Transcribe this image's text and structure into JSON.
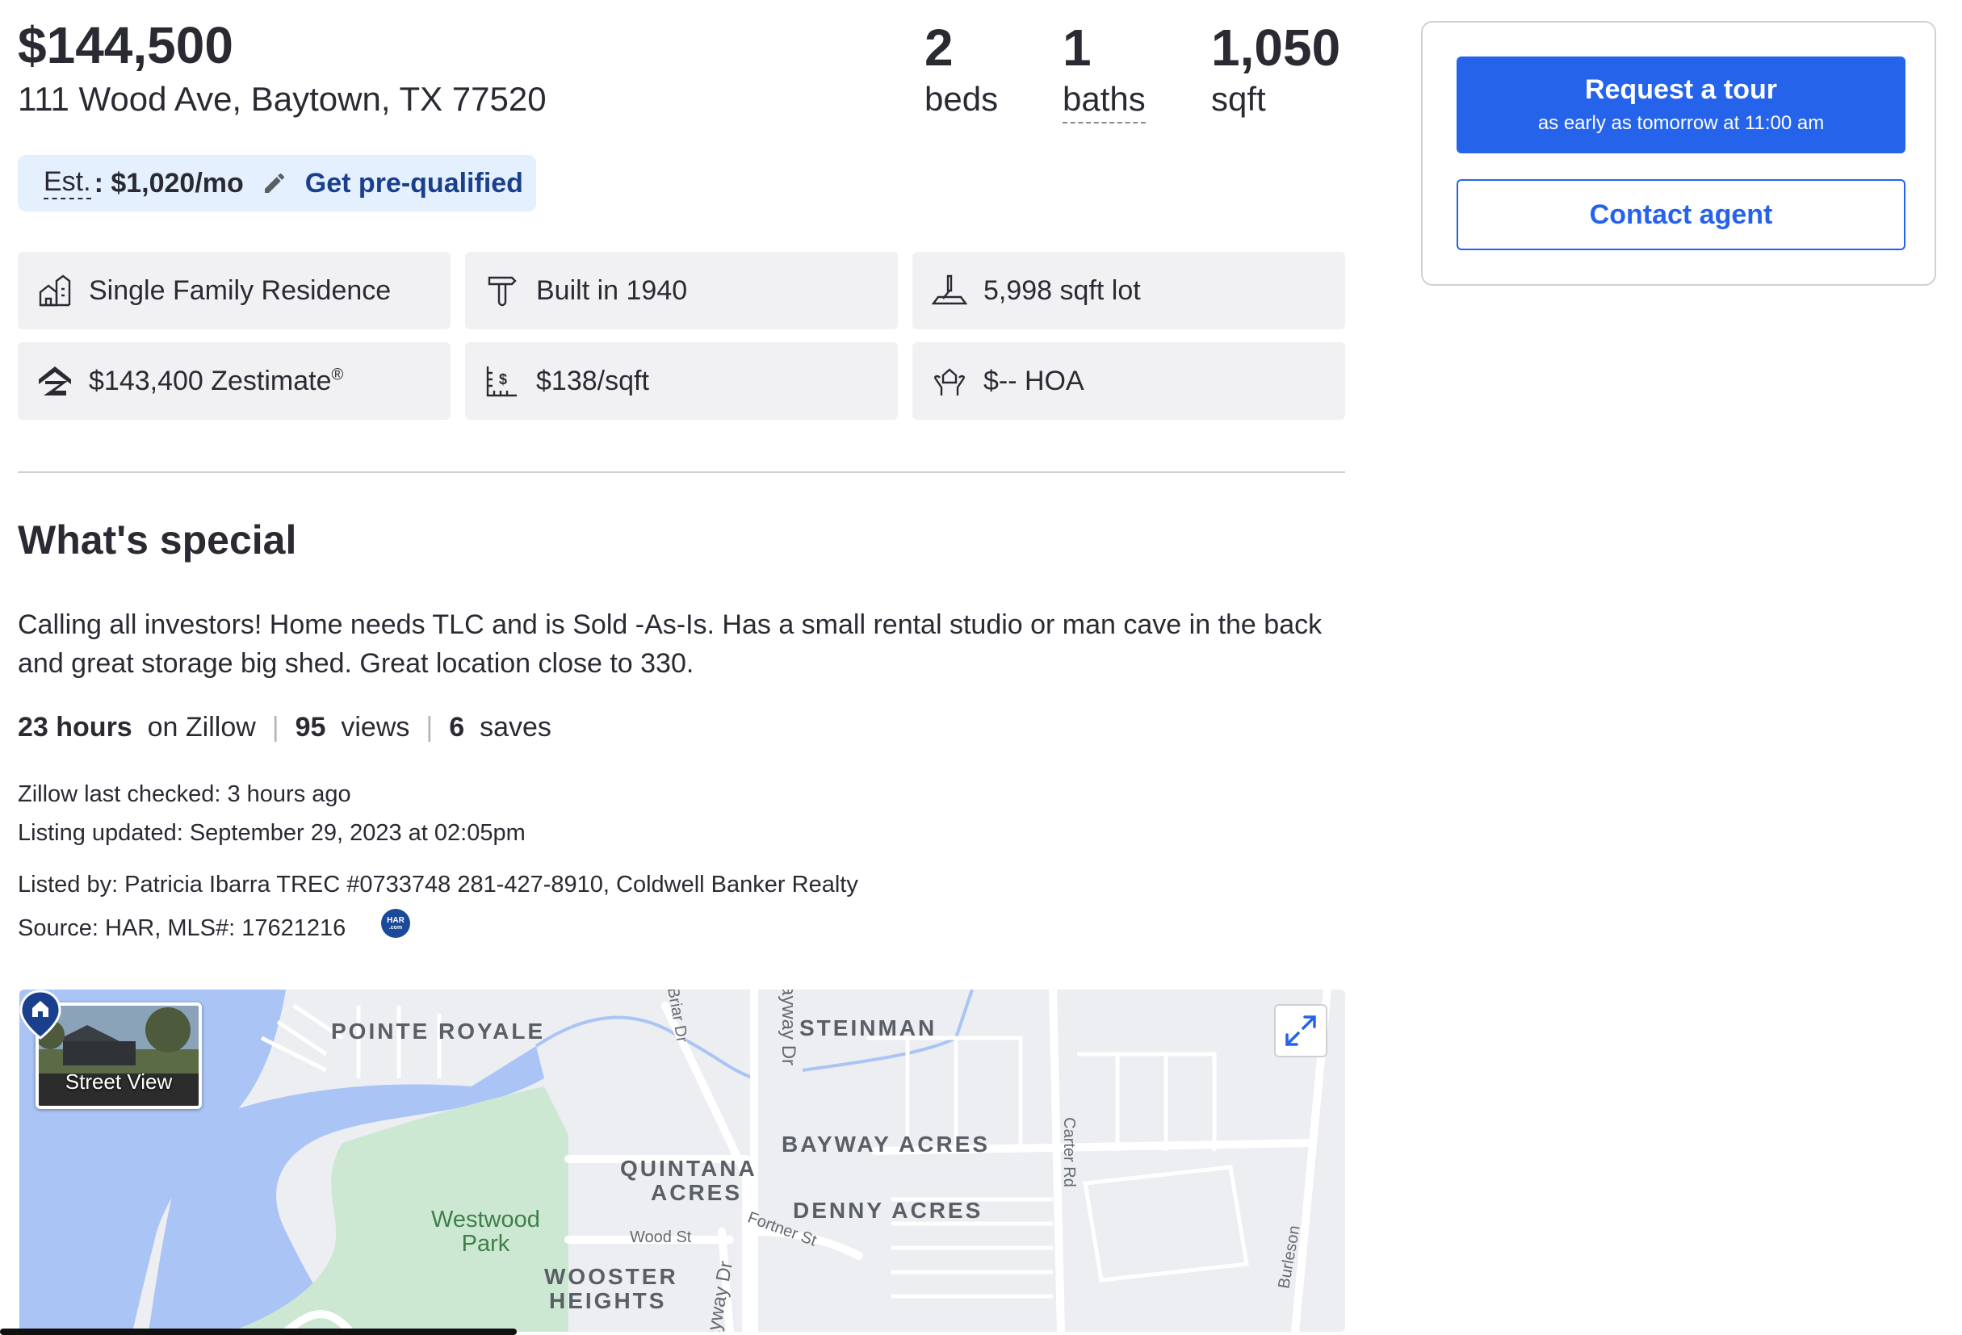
{
  "listing": {
    "price": "$144,500",
    "address": "111 Wood Ave, Baytown, TX 77520",
    "beds": {
      "value": "2",
      "label": "beds"
    },
    "baths": {
      "value": "1",
      "label": "baths"
    },
    "sqft": {
      "value": "1,050",
      "label": "sqft"
    }
  },
  "estimate": {
    "label": "Est.",
    "value": ": $1,020/mo",
    "prequal_link": "Get pre-qualified"
  },
  "facts": [
    {
      "icon": "home-type-icon",
      "text": "Single Family Residence"
    },
    {
      "icon": "hammer-icon",
      "text": "Built in 1940"
    },
    {
      "icon": "lot-size-icon",
      "text": "5,998 sqft lot"
    },
    {
      "icon": "zestimate-icon",
      "text": "$143,400 Zestimate",
      "sup": "®"
    },
    {
      "icon": "price-per-sqft-icon",
      "text": "$138/sqft"
    },
    {
      "icon": "hoa-icon",
      "text": "$-- HOA"
    }
  ],
  "special": {
    "title": "What's special",
    "description": "Calling all investors! Home needs TLC and is Sold -As-Is. Has a small rental studio or man cave in the back and great storage big shed. Great location close to 330."
  },
  "activity": {
    "time_value": "23 hours",
    "time_label": "on Zillow",
    "views_value": "95",
    "views_label": "views",
    "saves_value": "6",
    "saves_label": "saves"
  },
  "meta": {
    "last_checked": "Zillow last checked: 3 hours ago",
    "updated": "Listing updated: September 29, 2023 at 02:05pm",
    "listed_by": "Listed by: Patricia Ibarra TREC #0733748 281-427-8910, Coldwell Banker Realty",
    "source": "Source: HAR,  MLS#: 17621216",
    "har_logo_text": "HAR",
    "har_logo_sub": ".com"
  },
  "map": {
    "street_view_label": "Street View",
    "areas": [
      "POINTE ROYALE",
      "STEINMAN",
      "BAYWAY ACRES",
      "QUINTANA",
      "ACRES",
      "DENNY ACRES",
      "WOOSTER",
      "HEIGHTS"
    ],
    "park": [
      "Westwood",
      "Park"
    ],
    "roads": [
      "Briar Dr",
      "Bayway Dr",
      "Carter Rd",
      "Wood St",
      "Fortner St",
      "Burleson",
      "Bayway Dr"
    ]
  },
  "actions": {
    "tour_title": "Request a tour",
    "tour_subtitle": "as early as tomorrow at 11:00 am",
    "contact": "Contact agent"
  },
  "colors": {
    "primary": "#2563eb",
    "pill_bg": "#e4f0fd",
    "fact_bg": "#f1f1f4",
    "water": "#a9c4f5",
    "park": "#cde8d2"
  }
}
